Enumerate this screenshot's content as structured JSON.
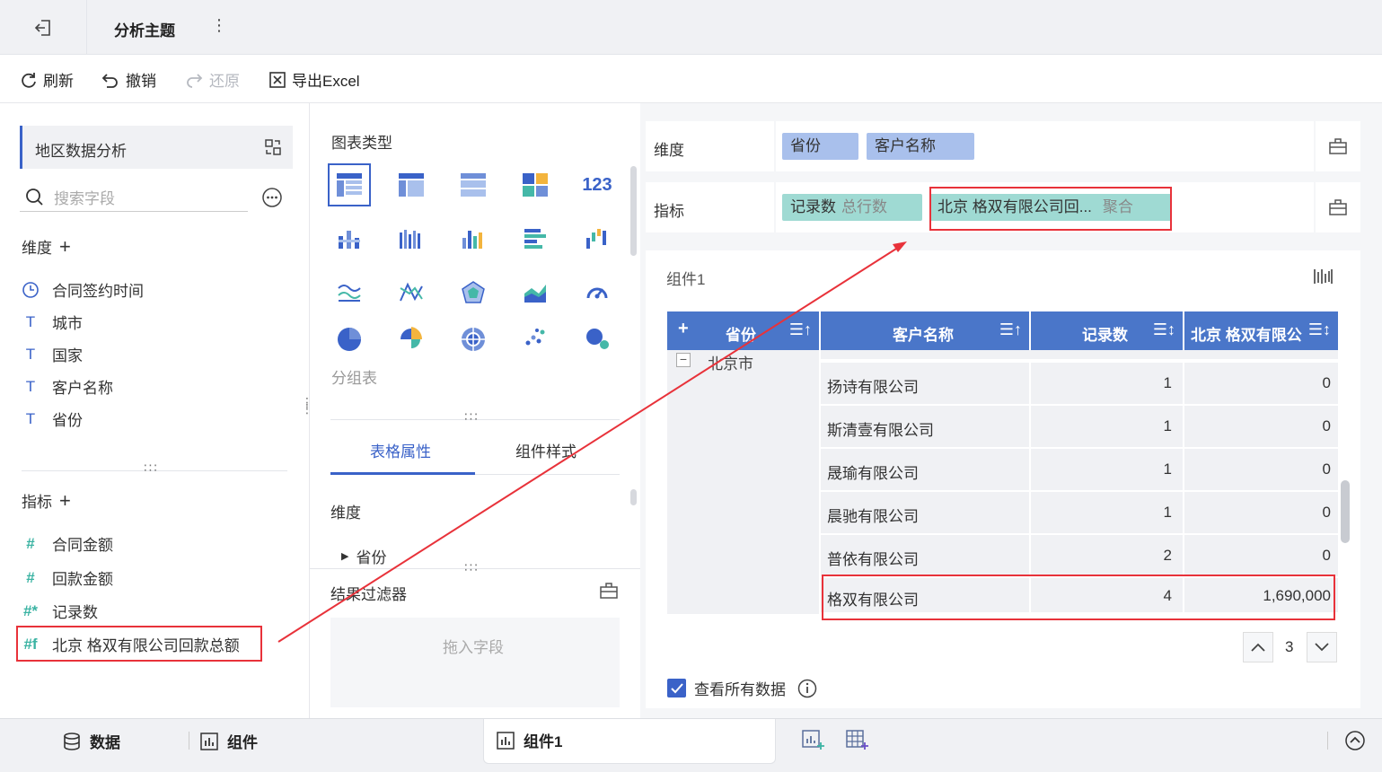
{
  "topbar": {
    "title": "分析主题"
  },
  "toolbar": {
    "refresh": "刷新",
    "undo": "撤销",
    "redo": "还原",
    "export": "导出Excel"
  },
  "left": {
    "dataset": "地区数据分析",
    "search_placeholder": "搜索字段",
    "dimension_header": "维度",
    "dimensions": [
      "合同签约时间",
      "城市",
      "国家",
      "客户名称",
      "省份"
    ],
    "metric_header": "指标",
    "metrics": [
      "合同金额",
      "回款金额",
      "记录数",
      "北京 格双有限公司回款总额"
    ]
  },
  "mid": {
    "chart_type_title": "图表类型",
    "chart_type_name": "分组表",
    "tabs": [
      "表格属性",
      "组件样式"
    ],
    "dimension_label": "维度",
    "dimension_item": "省份",
    "filter_title": "结果过滤器",
    "drop_hint": "拖入字段"
  },
  "right": {
    "dim_label": "维度",
    "dim_chips": [
      "省份",
      "客户名称"
    ],
    "metric_label": "指标",
    "metric_chips": [
      {
        "name": "记录数",
        "sub": "总行数"
      },
      {
        "name": "北京 格双有限公司回...",
        "sub": "聚合"
      }
    ],
    "component_title": "组件1",
    "table": {
      "headers": [
        "省份",
        "客户名称",
        "记录数",
        "北京 格双有限公"
      ],
      "group": "北京市",
      "rows": [
        [
          "扬诗有限公司",
          "1",
          "0"
        ],
        [
          "斯清壹有限公司",
          "1",
          "0"
        ],
        [
          "晟瑜有限公司",
          "1",
          "0"
        ],
        [
          "晨驰有限公司",
          "1",
          "0"
        ],
        [
          "普依有限公司",
          "2",
          "0"
        ],
        [
          "格双有限公司",
          "4",
          "1,690,000"
        ]
      ]
    },
    "page": "3",
    "view_all": "查看所有数据"
  },
  "footer": {
    "data": "数据",
    "component": "组件",
    "active_tab": "组件1"
  },
  "colors": {
    "accent": "#3a62c8",
    "header_blue": "#4a76c9",
    "dim_chip": "#a9c0ec",
    "metric_chip": "#9fdad3",
    "highlight": "#e8323a"
  }
}
